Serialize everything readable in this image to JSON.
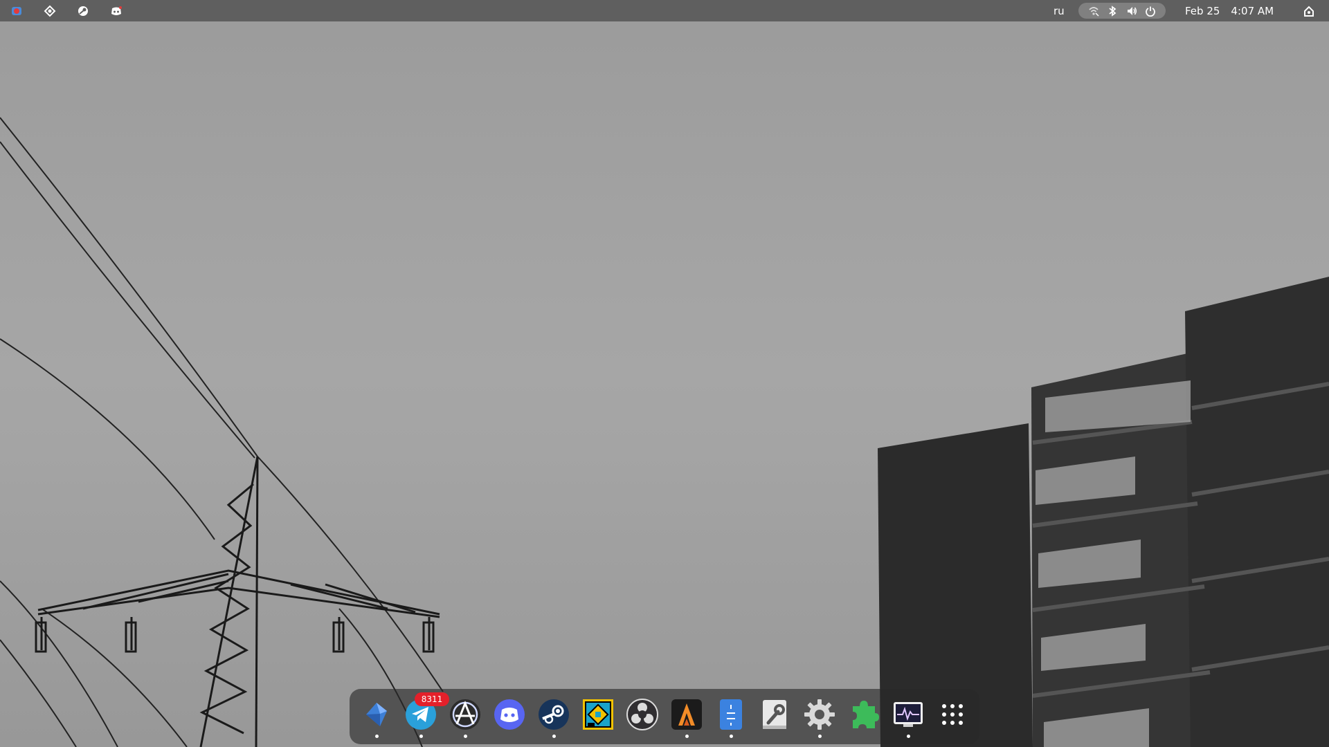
{
  "top_bar": {
    "tray_left": [
      {
        "name": "screenshot-app-tray-icon",
        "color": "#e23b3b"
      },
      {
        "name": "launcher-tray-icon"
      },
      {
        "name": "steam-tray-icon"
      },
      {
        "name": "discord-tray-icon"
      }
    ],
    "keyboard_layout": "ru",
    "status_icons": [
      "network-icon",
      "bluetooth-icon",
      "volume-icon",
      "power-icon"
    ],
    "date": "Feb 25",
    "time": "4:07 AM",
    "corner_icon": "notifications-icon"
  },
  "dock": {
    "items": [
      {
        "name": "dock-item-discover",
        "icon": "discover-icon",
        "running": true
      },
      {
        "name": "dock-item-telegram",
        "icon": "telegram-icon",
        "running": true,
        "badge": "8311"
      },
      {
        "name": "dock-item-anarchy-app",
        "icon": "anarchy-icon",
        "running": true
      },
      {
        "name": "dock-item-discord",
        "icon": "discord-icon",
        "running": false
      },
      {
        "name": "dock-item-steam",
        "icon": "steam-icon",
        "running": true
      },
      {
        "name": "dock-item-geometry-dash",
        "icon": "geometry-dash-icon",
        "running": false
      },
      {
        "name": "dock-item-obs",
        "icon": "obs-icon",
        "running": false
      },
      {
        "name": "dock-item-alacritty",
        "icon": "alacritty-icon",
        "running": true
      },
      {
        "name": "dock-item-text-editor",
        "icon": "text-editor-icon",
        "running": true
      },
      {
        "name": "dock-item-tweaks",
        "icon": "tweaks-icon",
        "running": false
      },
      {
        "name": "dock-item-settings",
        "icon": "settings-gear-icon",
        "running": true
      },
      {
        "name": "dock-item-extensions",
        "icon": "extensions-puzzle-icon",
        "running": false
      },
      {
        "name": "dock-item-system-monitor",
        "icon": "system-monitor-icon",
        "running": true
      },
      {
        "name": "dock-item-show-apps",
        "icon": "app-grid-icon",
        "running": false
      }
    ]
  },
  "colors": {
    "panel": "#5f5f5f",
    "badge": "#e4202a",
    "telegram": "#2aa0da",
    "discord": "#5865f2",
    "extensions": "#3dbb5a"
  }
}
